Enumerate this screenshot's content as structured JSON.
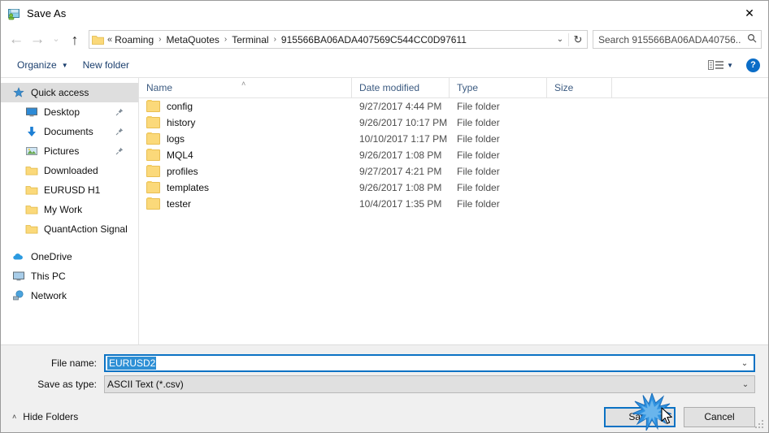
{
  "window": {
    "title": "Save As",
    "title_icon": "save-as-icon",
    "close_label": "✕"
  },
  "nav": {
    "back_icon": "←",
    "forward_icon": "→",
    "recent_icon": "⌄",
    "up_icon": "↑",
    "address": {
      "lead": "«",
      "folder_icon": "folder-icon",
      "crumbs": [
        "Roaming",
        "MetaQuotes",
        "Terminal",
        "915566BA06ADA407569C544CC0D97611"
      ],
      "separator": "›",
      "dropdown_icon": "⌄",
      "refresh_icon": "↻"
    },
    "search": {
      "placeholder": "Search 915566BA06ADA40756...",
      "value": "",
      "icon": "search-icon"
    }
  },
  "commandbar": {
    "organize_label": "Organize",
    "organize_caret": "▼",
    "new_folder_label": "New folder",
    "view_caret": "▼",
    "help_label": "?"
  },
  "sidebar": {
    "items": [
      {
        "label": "Quick access",
        "icon": "star-icon",
        "selected": true,
        "level": "root",
        "pinned": false
      },
      {
        "label": "Desktop",
        "icon": "desktop-icon",
        "selected": false,
        "level": "child",
        "pinned": true
      },
      {
        "label": "Documents",
        "icon": "documents-icon",
        "selected": false,
        "level": "child",
        "pinned": true
      },
      {
        "label": "Pictures",
        "icon": "pictures-icon",
        "selected": false,
        "level": "child",
        "pinned": true
      },
      {
        "label": "Downloaded",
        "icon": "folder-icon",
        "selected": false,
        "level": "child",
        "pinned": false
      },
      {
        "label": "EURUSD H1",
        "icon": "folder-icon",
        "selected": false,
        "level": "child",
        "pinned": false
      },
      {
        "label": "My Work",
        "icon": "folder-icon",
        "selected": false,
        "level": "child",
        "pinned": false
      },
      {
        "label": "QuantAction Signal",
        "icon": "folder-icon",
        "selected": false,
        "level": "child",
        "pinned": false
      },
      {
        "label": "OneDrive",
        "icon": "cloud-icon",
        "selected": false,
        "level": "root",
        "pinned": false
      },
      {
        "label": "This PC",
        "icon": "pc-icon",
        "selected": false,
        "level": "root",
        "pinned": false
      },
      {
        "label": "Network",
        "icon": "network-icon",
        "selected": false,
        "level": "root",
        "pinned": false
      }
    ],
    "pin_glyph": "📌"
  },
  "filelist": {
    "columns": [
      "Name",
      "Date modified",
      "Type",
      "Size"
    ],
    "sort_caret": "˄",
    "rows": [
      {
        "name": "config",
        "date": "9/27/2017 4:44 PM",
        "type": "File folder",
        "size": ""
      },
      {
        "name": "history",
        "date": "9/26/2017 10:17 PM",
        "type": "File folder",
        "size": ""
      },
      {
        "name": "logs",
        "date": "10/10/2017 1:17 PM",
        "type": "File folder",
        "size": ""
      },
      {
        "name": "MQL4",
        "date": "9/26/2017 1:08 PM",
        "type": "File folder",
        "size": ""
      },
      {
        "name": "profiles",
        "date": "9/27/2017 4:21 PM",
        "type": "File folder",
        "size": ""
      },
      {
        "name": "templates",
        "date": "9/26/2017 1:08 PM",
        "type": "File folder",
        "size": ""
      },
      {
        "name": "tester",
        "date": "10/4/2017 1:35 PM",
        "type": "File folder",
        "size": ""
      }
    ]
  },
  "form": {
    "file_name_label": "File name:",
    "file_name_value": "EURUSD2",
    "save_as_type_label": "Save as type:",
    "save_as_type_value": "ASCII Text (*.csv)",
    "dropdown_icon": "⌄"
  },
  "footer": {
    "hide_folders_label": "Hide Folders",
    "hide_folders_caret": "˄",
    "save_label": "Save",
    "cancel_label": "Cancel"
  },
  "colors": {
    "accent": "#0b72c4",
    "selection": "#2d8fd5",
    "folder": "#fbd97a",
    "header_text": "#3c5b81",
    "command_text": "#1b3f6e"
  }
}
